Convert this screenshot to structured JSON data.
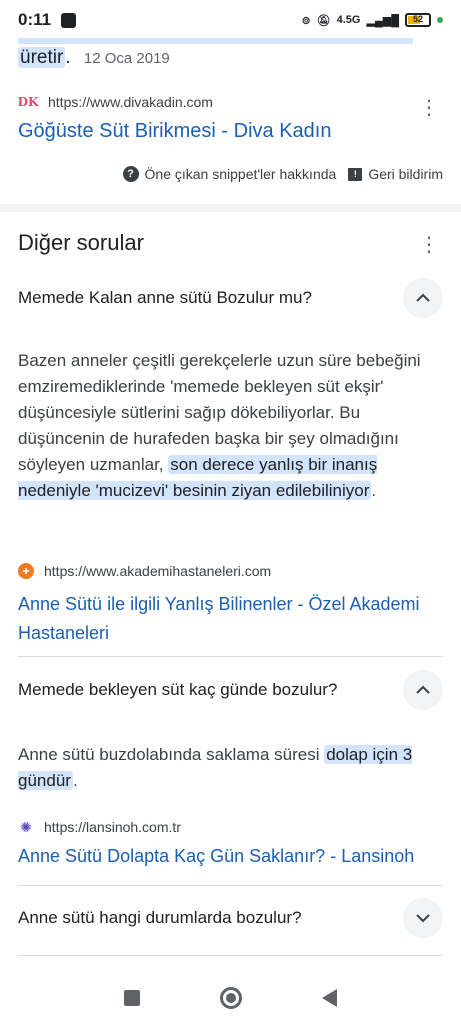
{
  "status": {
    "time": "0:11",
    "network": "4.5G",
    "battery": "52",
    "accent_dot": "#34a853"
  },
  "top_snippet": {
    "clipped_text": "...",
    "line_end": "üretir",
    "period": ".",
    "date": "12 Oca 2019"
  },
  "result1": {
    "favicon": "DK",
    "url": "https://www.divakadin.com",
    "title": "Göğüste Süt Birikmesi - Diva Kadın"
  },
  "feedback": {
    "about_label": "Öne çıkan snippet'ler hakkında",
    "feedback_label": "Geri bildirim"
  },
  "paa": {
    "title": "Diğer sorular",
    "questions": [
      {
        "question": "Memede Kalan anne sütü Bozulur mu?",
        "expanded": true,
        "answer_plain": "Bazen anneler çeşitli gerekçelerle uzun süre bebeğini emziremediklerinde 'memede bekleyen süt ekşir' düşüncesiyle sütlerini sağıp dökebiliyorlar. Bu düşüncenin de hurafeden başka bir şey olmadığını söyleyen uzmanlar, ",
        "answer_highlight": "son derece yanlış bir inanış nedeniyle 'mucizevi' besinin ziyan edilebiliniyor",
        "answer_end": ".",
        "source_url": "https://www.akademihastaneleri.com",
        "source_title": "Anne Sütü ile ilgili Yanlış Bilinenler - Özel Akademi Hastaneleri"
      },
      {
        "question": "Memede bekleyen süt kaç günde bozulur?",
        "expanded": true,
        "answer_plain": "Anne sütü buzdolabında saklama süresi ",
        "answer_highlight": "dolap için 3 gündür",
        "answer_end": ".",
        "source_url": "https://lansinoh.com.tr",
        "source_title": "Anne Sütü Dolapta Kaç Gün Saklanır? - Lansinoh"
      },
      {
        "question": "Anne sütü hangi durumlarda bozulur?",
        "expanded": false
      }
    ]
  },
  "colors": {
    "highlight": "#d2e3fc",
    "link": "#1a5fb4"
  }
}
